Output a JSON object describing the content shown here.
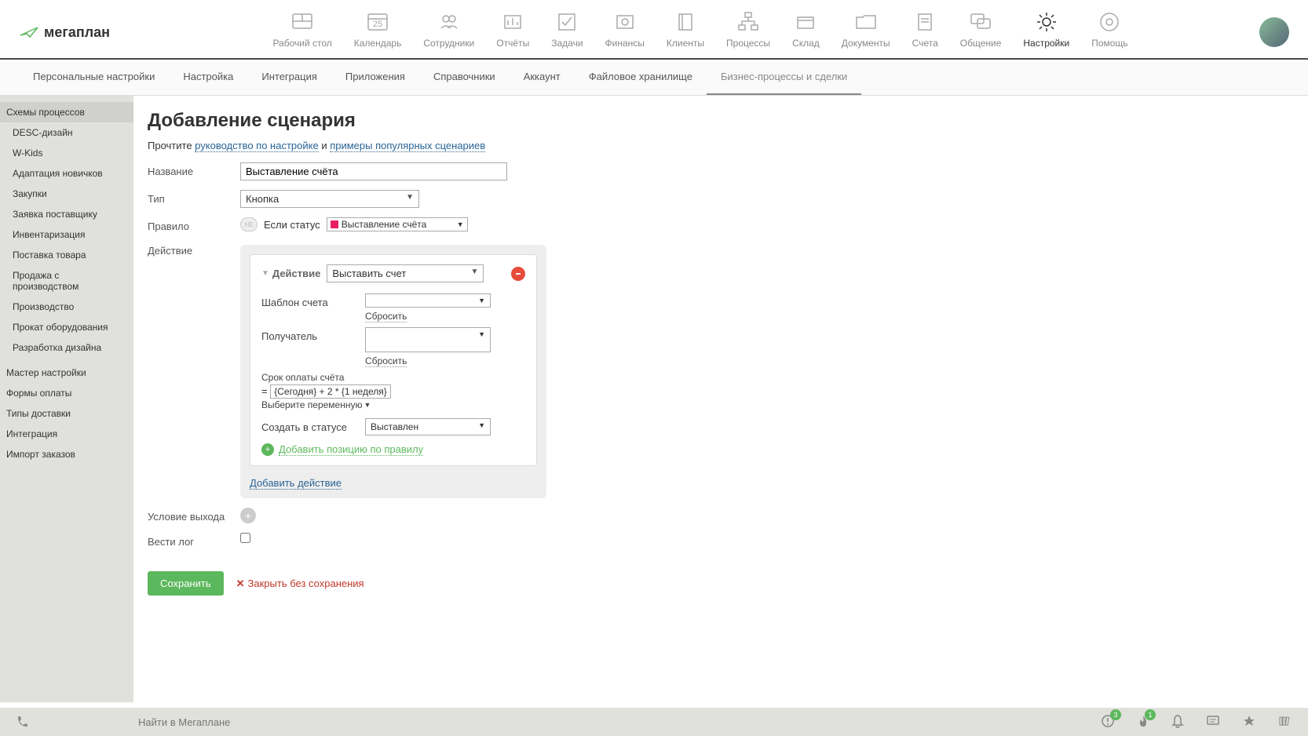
{
  "logo": "мегаплан",
  "topnav": [
    {
      "label": "Рабочий стол",
      "icon": "desktop"
    },
    {
      "label": "Календарь",
      "icon": "calendar",
      "badge": "25"
    },
    {
      "label": "Сотрудники",
      "icon": "people"
    },
    {
      "label": "Отчёты",
      "icon": "chart"
    },
    {
      "label": "Задачи",
      "icon": "check"
    },
    {
      "label": "Финансы",
      "icon": "safe"
    },
    {
      "label": "Клиенты",
      "icon": "book"
    },
    {
      "label": "Процессы",
      "icon": "flow"
    },
    {
      "label": "Склад",
      "icon": "box"
    },
    {
      "label": "Документы",
      "icon": "folder"
    },
    {
      "label": "Счета",
      "icon": "invoice"
    },
    {
      "label": "Общение",
      "icon": "chat"
    },
    {
      "label": "Настройки",
      "icon": "gear",
      "active": true
    },
    {
      "label": "Помощь",
      "icon": "help"
    }
  ],
  "subnav": [
    "Персональные настройки",
    "Настройка",
    "Интеграция",
    "Приложения",
    "Справочники",
    "Аккаунт",
    "Файловое хранилище",
    "Бизнес-процессы и сделки"
  ],
  "subnav_active": "Бизнес-процессы и сделки",
  "sidebar": {
    "header": "Схемы процессов",
    "schemes": [
      "DESC-дизайн",
      "W-Kids",
      "Адаптация новичков",
      "Закупки",
      "Заявка поставщику",
      "Инвентаризация",
      "Поставка товара",
      "Продажа с производством",
      "Производство",
      "Прокат оборудования",
      "Разработка дизайна"
    ],
    "extras": [
      "Мастер настройки",
      "Формы оплаты",
      "Типы доставки",
      "Интеграция",
      "Импорт заказов"
    ]
  },
  "page": {
    "title": "Добавление сценария",
    "hint_prefix": "Прочтите ",
    "hint_link1": "руководство по настройке",
    "hint_middle": " и ",
    "hint_link2": "примеры популярных сценариев",
    "labels": {
      "name": "Название",
      "type": "Тип",
      "rule": "Правило",
      "action": "Действие",
      "exit": "Условие выхода",
      "log": "Вести лог"
    },
    "name_value": "Выставление счёта",
    "type_value": "Кнопка",
    "rule": {
      "toggle": "НЕ",
      "if_status": "Если статус",
      "status_value": "Выставление счёта"
    },
    "action_block": {
      "label": "Действие",
      "action_select": "Выставить счет",
      "template_label": "Шаблон счета",
      "template_value": "",
      "reset": "Сбросить",
      "recipient_label": "Получатель",
      "recipient_value": "",
      "due_label": "Срок оплаты счёта",
      "due_prefix": "= ",
      "due_formula": "{Сегодня} + 2 * {1 неделя}",
      "var_link": "Выберите переменную",
      "create_status_label": "Создать в статусе",
      "create_status_value": "Выставлен",
      "add_position": "Добавить позицию по правилу",
      "add_action": "Добавить действие"
    },
    "save": "Сохранить",
    "cancel": "Закрыть без сохранения"
  },
  "footer": {
    "search_placeholder": "Найти в Мегаплане",
    "badge1": "3",
    "badge2": "1"
  }
}
